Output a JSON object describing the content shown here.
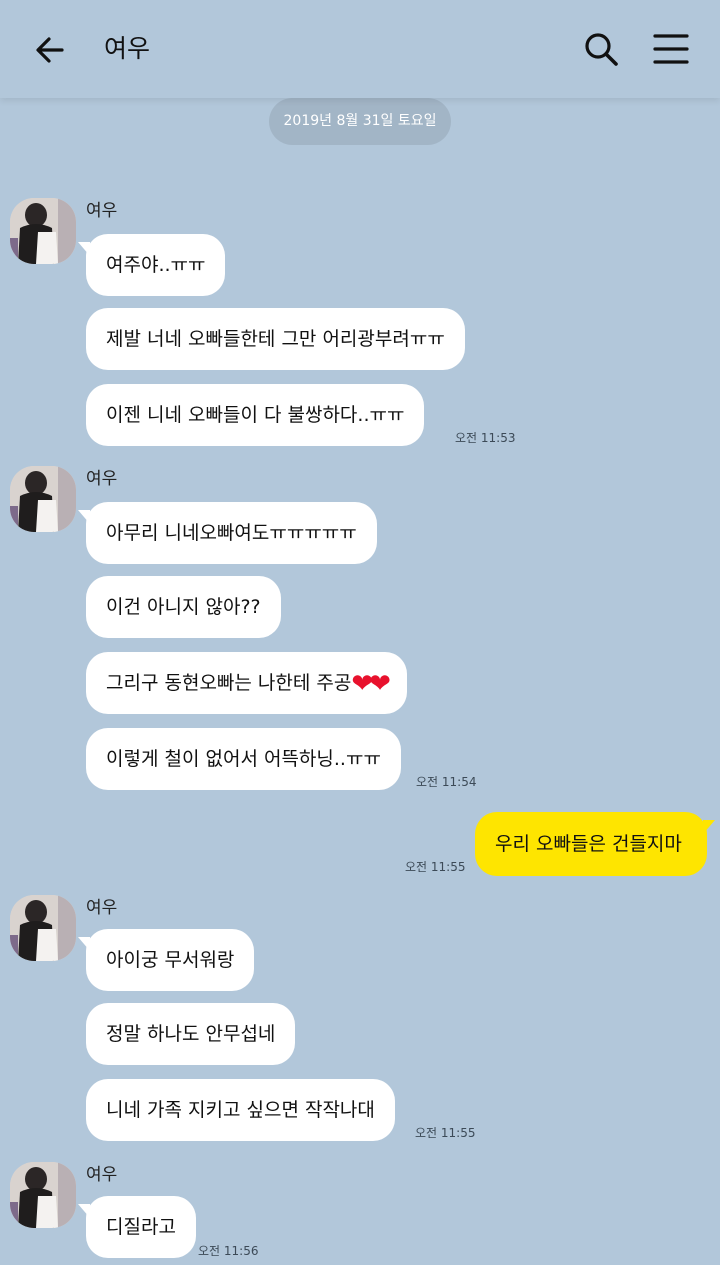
{
  "header": {
    "title": "여우",
    "back_icon": "arrow-left-icon",
    "search_icon": "search-icon",
    "menu_icon": "hamburger-menu-icon"
  },
  "date_separator": "2019년 8월 31일 토요일",
  "colors": {
    "background": "#b2c7da",
    "my_bubble": "#fee500",
    "their_bubble": "#ffffff",
    "date_pill": "#a2b5c6"
  },
  "groups": [
    {
      "sender": "여우",
      "messages": [
        "여주야..ㅠㅠ",
        "제발 너네 오빠들한테 그만 어리광부려ㅠㅠ",
        "이젠 니네 오빠들이 다 불쌍하다..ㅠㅠ"
      ],
      "time": "오전 11:53"
    },
    {
      "sender": "여우",
      "messages": [
        "아무리 니네오빠여도ㅠㅠㅠㅠㅠ",
        "이건 아니지 않아??",
        "그리구 동현오빠는 나한테 주공",
        "이렇게 철이 없어서 어뜩하닝..ㅠㅠ"
      ],
      "time": "오전 11:54",
      "hearts": "❤❤"
    },
    {
      "sender": "여우",
      "messages": [
        "아이궁 무서워랑",
        "정말 하나도 안무섭네",
        "니네 가족 지키고 싶으면 작작나대"
      ],
      "time": "오전 11:55"
    },
    {
      "sender": "여우",
      "messages": [
        "디질라고"
      ],
      "time": "오전 11:56"
    }
  ],
  "my_message": {
    "text": "우리 오빠들은 건들지마",
    "time": "오전 11:55"
  }
}
